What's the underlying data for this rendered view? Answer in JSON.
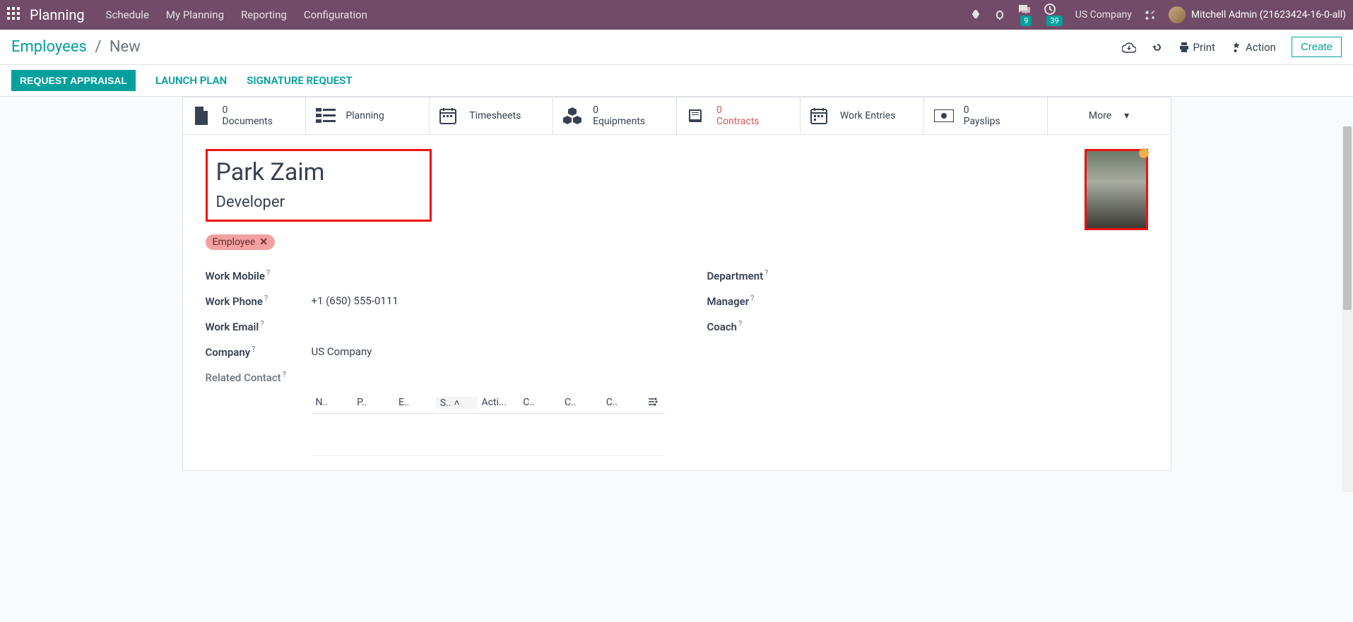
{
  "nav": {
    "brand": "Planning",
    "menu": [
      "Schedule",
      "My Planning",
      "Reporting",
      "Configuration"
    ],
    "msg_count": "9",
    "activity_count": "39",
    "company": "US Company",
    "user": "Mitchell Admin (21623424-16-0-all)"
  },
  "breadcrumb": {
    "root": "Employees",
    "current": "New"
  },
  "actions": {
    "print": "Print",
    "action": "Action",
    "create": "Create"
  },
  "status_buttons": {
    "primary": "REQUEST APPRAISAL",
    "launch": "LAUNCH PLAN",
    "signature": "SIGNATURE REQUEST"
  },
  "stats": [
    {
      "count": "0",
      "label": "Documents"
    },
    {
      "count": "",
      "label": "Planning"
    },
    {
      "count": "",
      "label": "Timesheets"
    },
    {
      "count": "0",
      "label": "Equipments"
    },
    {
      "count": "0",
      "label": "Contracts",
      "red": true
    },
    {
      "count": "",
      "label": "Work Entries"
    },
    {
      "count": "0",
      "label": "Payslips"
    },
    {
      "count": "",
      "label": "More"
    }
  ],
  "employee": {
    "name": "Park Zaim",
    "title": "Developer",
    "tag": "Employee",
    "work_mobile_label": "Work Mobile",
    "work_phone_label": "Work Phone",
    "work_phone": "+1 (650) 555-0111",
    "work_email_label": "Work Email",
    "company_label": "Company",
    "company": "US Company",
    "related_contact_label": "Related Contact",
    "department_label": "Department",
    "manager_label": "Manager",
    "coach_label": "Coach"
  },
  "subtable": {
    "cols": [
      "N..",
      "P..",
      "E..",
      "S..",
      "Acti...",
      "C..",
      "C..",
      "C.."
    ]
  }
}
